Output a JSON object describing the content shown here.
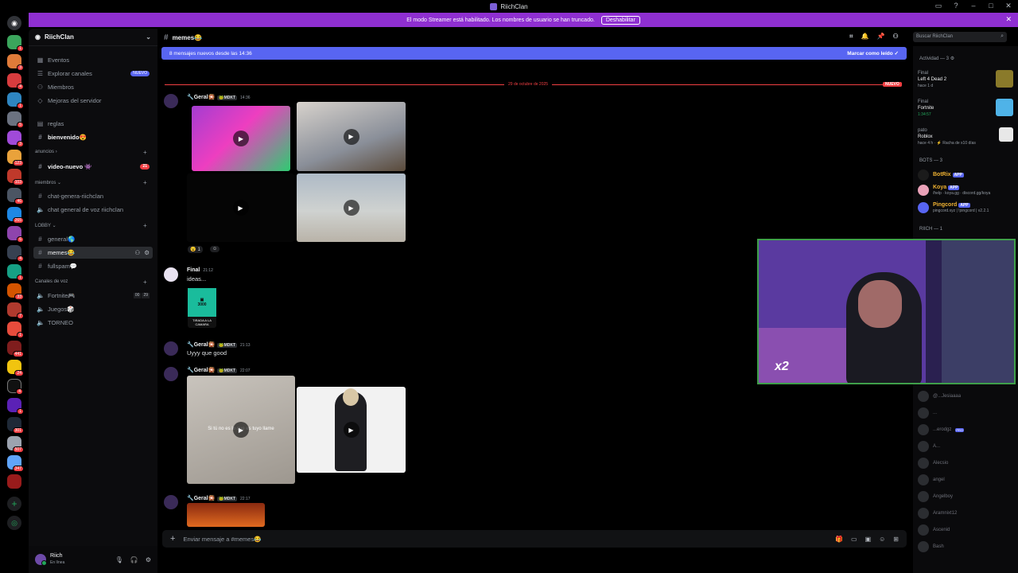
{
  "app": {
    "title": "RiichClan"
  },
  "guild_badges": [
    "1",
    "3",
    "4",
    "1",
    "5",
    "3",
    "123",
    "103",
    "46",
    "265",
    "6",
    "4",
    "1",
    "33",
    "7",
    "1",
    "441",
    "24",
    "4",
    "1",
    "301",
    "507",
    "347"
  ],
  "streamer": {
    "message": "El modo Streamer está habilitado. Los nombres de usuario se han truncado.",
    "button": "Deshabilitar"
  },
  "server": {
    "name": "RiichClan"
  },
  "channels": {
    "eventos": "Eventos",
    "explorar": "Explorar canales",
    "nuevo_pill": "NUEVO",
    "miembros": "Miembros",
    "mejoras": "Mejoras del servidor",
    "reglas": "reglas",
    "bienvenido": "bienvenido😍",
    "cat_anuncios": "anuncios",
    "video_nuevo": "video-nuevo 👾",
    "video_badge": "21",
    "cat_miembros": "miembros",
    "chat_genera": "chat-genera-riichclan",
    "chat_voz": "chat general de voz riichclan",
    "cat_lobby": "LOBBY",
    "general": "general🌎",
    "memes": "memes😂",
    "fullspam": "fullspam💬",
    "cat_voz": "Canales de voz",
    "fortnite": "Fortnite🎮",
    "fortnite_a": "00",
    "fortnite_b": "29",
    "juegos": "Juegos🎲",
    "torneo": "TORNEO"
  },
  "user": {
    "name": "Riich",
    "status": "En línea"
  },
  "chat": {
    "channel": "memes😂",
    "search_placeholder": "Buscar RiichClan",
    "new_messages": "8 mensajes nuevos desde las 14:36",
    "mark_read": "Marcar como leído",
    "divider_date": "29 de octubre de 2025",
    "nuevo": "NUEVO",
    "composer_placeholder": "Enviar mensaje a #memes😂"
  },
  "messages": [
    {
      "author": "🔧Geral🎇",
      "tag": "🐸MDKT",
      "time": "14:36"
    },
    {
      "author": "Final",
      "time": "21:12",
      "text": "ideas...",
      "sticker_num": "3000",
      "sticker_caption": "TIRADA A LA CAMARA"
    },
    {
      "author": "🔧Geral🎇",
      "tag": "🐸MDKT",
      "time": "21:13",
      "text": "Uyyy que good"
    },
    {
      "author": "🔧Geral🎇",
      "tag": "🐸MDKT",
      "time": "22:07",
      "overlay_text": "Si tú no es lo que es tuyo llame"
    },
    {
      "author": "🔧Geral🎇",
      "tag": "🐸MDKT",
      "time": "22:17"
    }
  ],
  "reaction": {
    "emoji": "😮",
    "count": "1"
  },
  "members": {
    "activity_header": "Actividad — 3",
    "activities": [
      {
        "user": "Final",
        "game": "Left 4 Dead 2",
        "detail": "hace 1 d"
      },
      {
        "user": "Final",
        "game": "Fortnite",
        "detail": "1:34:57"
      },
      {
        "user": "pato",
        "game": "Roblox",
        "detail": "hace 4 h · ⚡ Racha de x10 días"
      }
    ],
    "bots_header": "BOTS — 3",
    "bots": [
      {
        "name": "BotRix",
        "app": "APP",
        "status": ""
      },
      {
        "name": "Koya",
        "app": "APP",
        "status": "/help · koya.gg · discord.gg/koya"
      },
      {
        "name": "Pingcord",
        "app": "APP",
        "status": "pingcord.xyz | !pingcord | v2.2.1"
      }
    ],
    "riich_header": "RIICH — 1",
    "offline": [
      "@...Jesiaaaa",
      "...",
      "...erodgz",
      "A...",
      "Alecsio",
      "angel",
      "Angelboy",
      "Aramnixt12",
      "Ascenid",
      "Bash"
    ],
    "pro_tag": "PRO"
  },
  "overlay": {
    "multiplier": "x2"
  }
}
